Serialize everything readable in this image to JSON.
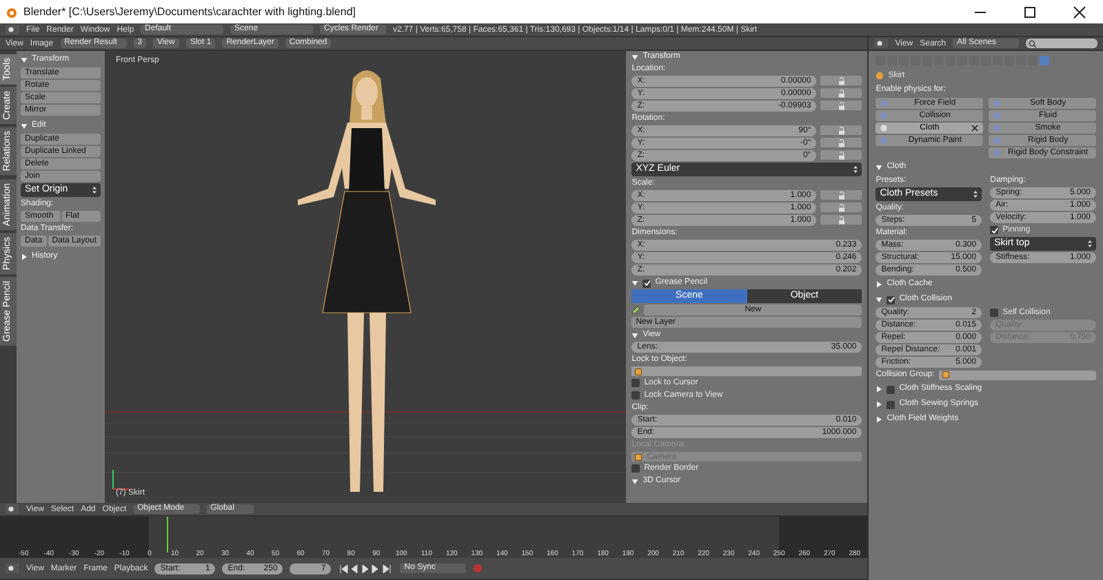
{
  "title_bar": {
    "title": "Blender* [C:\\Users\\Jeremy\\Documents\\carachter with lighting.blend]"
  },
  "info_header": {
    "menus": [
      "File",
      "Render",
      "Window",
      "Help"
    ],
    "layout": "Default",
    "scene": "Scene",
    "engine": "Cycles Render",
    "stats": "v2.77 | Verts:65,758 | Faces:65,361 | Tris:130,693 | Objects:1/14 | Lamps:0/1 | Mem:244.50M | Skirt"
  },
  "image_header": {
    "menus": [
      "View",
      "Image"
    ],
    "image": "Render Result",
    "frame": "3",
    "view": "View",
    "slot": "Slot 1",
    "layer": "RenderLayer",
    "pass": "Combined"
  },
  "toolbar": {
    "tabs": [
      {
        "label": "Tools",
        "selected": true
      },
      {
        "label": "Create",
        "selected": false
      },
      {
        "label": "Relations",
        "selected": false
      },
      {
        "label": "Animation",
        "selected": false
      },
      {
        "label": "Physics",
        "selected": false
      },
      {
        "label": "Grease Pencil",
        "selected": false
      }
    ],
    "panels": [
      {
        "title": "Transform",
        "expanded": true,
        "items": [
          {
            "kind": "button",
            "label": "Translate"
          },
          {
            "kind": "button",
            "label": "Rotate"
          },
          {
            "kind": "button",
            "label": "Scale"
          },
          {
            "kind": "button",
            "label": "Mirror"
          }
        ]
      },
      {
        "title": "Edit",
        "expanded": true,
        "items": [
          {
            "kind": "button",
            "label": "Duplicate"
          },
          {
            "kind": "button",
            "label": "Duplicate Linked"
          },
          {
            "kind": "button",
            "label": "Delete"
          },
          {
            "kind": "button",
            "label": "Join"
          },
          {
            "kind": "dropdown",
            "label": "Set Origin"
          },
          {
            "kind": "label",
            "label": "Shading:"
          },
          {
            "kind": "pair",
            "labels": [
              "Smooth",
              "Flat"
            ]
          },
          {
            "kind": "label",
            "label": "Data Transfer:"
          },
          {
            "kind": "pair",
            "labels": [
              "Data",
              "Data Layout"
            ]
          }
        ]
      },
      {
        "title": "History",
        "expanded": false
      }
    ]
  },
  "viewport": {
    "view_name": "Front Persp",
    "object_label": "(7) Skirt"
  },
  "n_panel": {
    "panels": [
      {
        "title": "Transform",
        "expanded": true,
        "items": [
          {
            "kind": "label",
            "label": "Location:"
          },
          {
            "kind": "num_lock",
            "label": "X:",
            "value": "0.00000",
            "locked": false
          },
          {
            "kind": "num_lock",
            "label": "Y:",
            "value": "0.00000",
            "locked": false
          },
          {
            "kind": "num_lock",
            "label": "Z:",
            "value": "-0.09903",
            "locked": false
          },
          {
            "kind": "label",
            "label": "Rotation:"
          },
          {
            "kind": "num_lock",
            "label": "X:",
            "value": "90°",
            "locked": false
          },
          {
            "kind": "num_lock",
            "label": "Y:",
            "value": "-0°",
            "locked": false
          },
          {
            "kind": "num_lock",
            "label": "Z:",
            "value": "0°",
            "locked": false
          },
          {
            "kind": "dropdown",
            "label": "XYZ Euler"
          },
          {
            "kind": "label",
            "label": "Scale:"
          },
          {
            "kind": "num_lock",
            "label": "X:",
            "value": "1.000",
            "locked": false
          },
          {
            "kind": "num_lock",
            "label": "Y:",
            "value": "1.000",
            "locked": false
          },
          {
            "kind": "num_lock",
            "label": "Z:",
            "value": "1.000",
            "locked": false
          },
          {
            "kind": "label",
            "label": "Dimensions:"
          },
          {
            "kind": "num",
            "label": "X:",
            "value": "0.233"
          },
          {
            "kind": "num",
            "label": "Y:",
            "value": "0.246"
          },
          {
            "kind": "num",
            "label": "Z:",
            "value": "0.202"
          }
        ]
      },
      {
        "title": "Grease Pencil",
        "expanded": true,
        "checked": true,
        "items": [
          {
            "kind": "tabs",
            "tabs": [
              {
                "label": "Scene",
                "selected": true
              },
              {
                "label": "Object",
                "selected": false
              }
            ]
          },
          {
            "kind": "datablock",
            "label": "New"
          },
          {
            "kind": "button",
            "label": "New Layer"
          }
        ]
      },
      {
        "title": "View",
        "expanded": true,
        "items": [
          {
            "kind": "num",
            "label": "Lens:",
            "value": "35.000"
          },
          {
            "kind": "label",
            "label": "Lock to Object:"
          },
          {
            "kind": "object_field",
            "disabled": false
          },
          {
            "kind": "check",
            "label": "Lock to Cursor",
            "checked": false
          },
          {
            "kind": "check",
            "label": "Lock Camera to View",
            "checked": false
          },
          {
            "kind": "label",
            "label": "Clip:"
          },
          {
            "kind": "num",
            "label": "Start:",
            "value": "0.010"
          },
          {
            "kind": "num",
            "label": "End:",
            "value": "1000.000"
          },
          {
            "kind": "label",
            "label": "Local Camera:",
            "disabled": true
          },
          {
            "kind": "object_field",
            "value": "Camera",
            "disabled": true
          },
          {
            "kind": "check",
            "label": "Render Border",
            "checked": false
          }
        ]
      },
      {
        "title": "3D Cursor",
        "expanded": true
      }
    ]
  },
  "view3d_header": {
    "menus": [
      "View",
      "Select",
      "Add",
      "Object"
    ],
    "mode": "Object Mode",
    "orientation": "Global"
  },
  "timeline": {
    "ticks": [
      "-50",
      "-40",
      "-30",
      "-20",
      "-10",
      "0",
      "10",
      "20",
      "30",
      "40",
      "50",
      "60",
      "70",
      "80",
      "90",
      "100",
      "110",
      "120",
      "130",
      "140",
      "150",
      "160",
      "170",
      "180",
      "190",
      "200",
      "210",
      "220",
      "230",
      "240",
      "250",
      "260",
      "270",
      "280"
    ]
  },
  "timeline_header": {
    "menus": [
      "View",
      "Marker",
      "Frame",
      "Playback"
    ],
    "start_label": "Start:",
    "start": "1",
    "end_label": "End:",
    "end": "250",
    "current": "7",
    "sync": "No Sync"
  },
  "properties": {
    "menus": [
      "View",
      "Search"
    ],
    "scope": "All Scenes",
    "breadcrumb": "Skirt",
    "physics_label": "Enable physics for:",
    "physics": [
      {
        "label": "Force Field",
        "enabled": false
      },
      {
        "label": "Soft Body",
        "enabled": false
      },
      {
        "label": "Collision",
        "enabled": false
      },
      {
        "label": "Fluid",
        "enabled": false
      },
      {
        "label": "Cloth",
        "enabled": true
      },
      {
        "label": "Smoke",
        "enabled": false
      },
      {
        "label": "Dynamic Paint",
        "enabled": false
      },
      {
        "label": "Rigid Body",
        "enabled": false
      },
      {
        "label": "Rigid Body Constraint",
        "enabled": false
      }
    ],
    "panels": [
      {
        "title": "Cloth",
        "expanded": true,
        "columns": [
          [
            {
              "kind": "label",
              "label": "Presets:"
            },
            {
              "kind": "dropdown",
              "label": "Cloth Presets"
            },
            {
              "kind": "label",
              "label": "Quality:"
            },
            {
              "kind": "num",
              "label": "Steps:",
              "value": "5"
            },
            {
              "kind": "label",
              "label": "Material:"
            },
            {
              "kind": "num",
              "label": "Mass:",
              "value": "0.300"
            },
            {
              "kind": "num",
              "label": "Structural:",
              "value": "15.000"
            },
            {
              "kind": "num",
              "label": "Bending:",
              "value": "0.500"
            }
          ],
          [
            {
              "kind": "label",
              "label": "Damping:"
            },
            {
              "kind": "num",
              "label": "Spring:",
              "value": "5.000"
            },
            {
              "kind": "num",
              "label": "Air:",
              "value": "1.000"
            },
            {
              "kind": "num",
              "label": "Velocity:",
              "value": "1.000"
            },
            {
              "kind": "check",
              "label": "Pinning",
              "checked": true
            },
            {
              "kind": "dropdown",
              "label": "Skirt top"
            },
            {
              "kind": "num",
              "label": "Stiffness:",
              "value": "1.000"
            }
          ]
        ]
      },
      {
        "title": "Cloth Cache",
        "expanded": false
      },
      {
        "title": "Cloth Collision",
        "expanded": true,
        "checked": true,
        "columns": [
          [
            {
              "kind": "num",
              "label": "Quality:",
              "value": "2"
            },
            {
              "kind": "num",
              "label": "Distance:",
              "value": "0.015"
            },
            {
              "kind": "num",
              "label": "Repel:",
              "value": "0.000"
            },
            {
              "kind": "num",
              "label": "Repel Distance:",
              "value": "0.001"
            },
            {
              "kind": "num",
              "label": "Friction:",
              "value": "5.000"
            }
          ],
          [
            {
              "kind": "check",
              "label": "Self Collision",
              "checked": false
            },
            {
              "kind": "num",
              "label": "Quality:",
              "disabled": true
            },
            {
              "kind": "num",
              "label": "Distance:",
              "value": "0.750",
              "disabled": true
            }
          ]
        ],
        "after": [
          {
            "kind": "object_field",
            "label": "Collision Group:",
            "disabled": false
          }
        ]
      },
      {
        "title": "Cloth Stiffness Scaling",
        "expanded": false,
        "checked": false
      },
      {
        "title": "Cloth Sewing Springs",
        "expanded": false,
        "checked": false
      },
      {
        "title": "Cloth Field Weights",
        "expanded": false
      }
    ]
  }
}
